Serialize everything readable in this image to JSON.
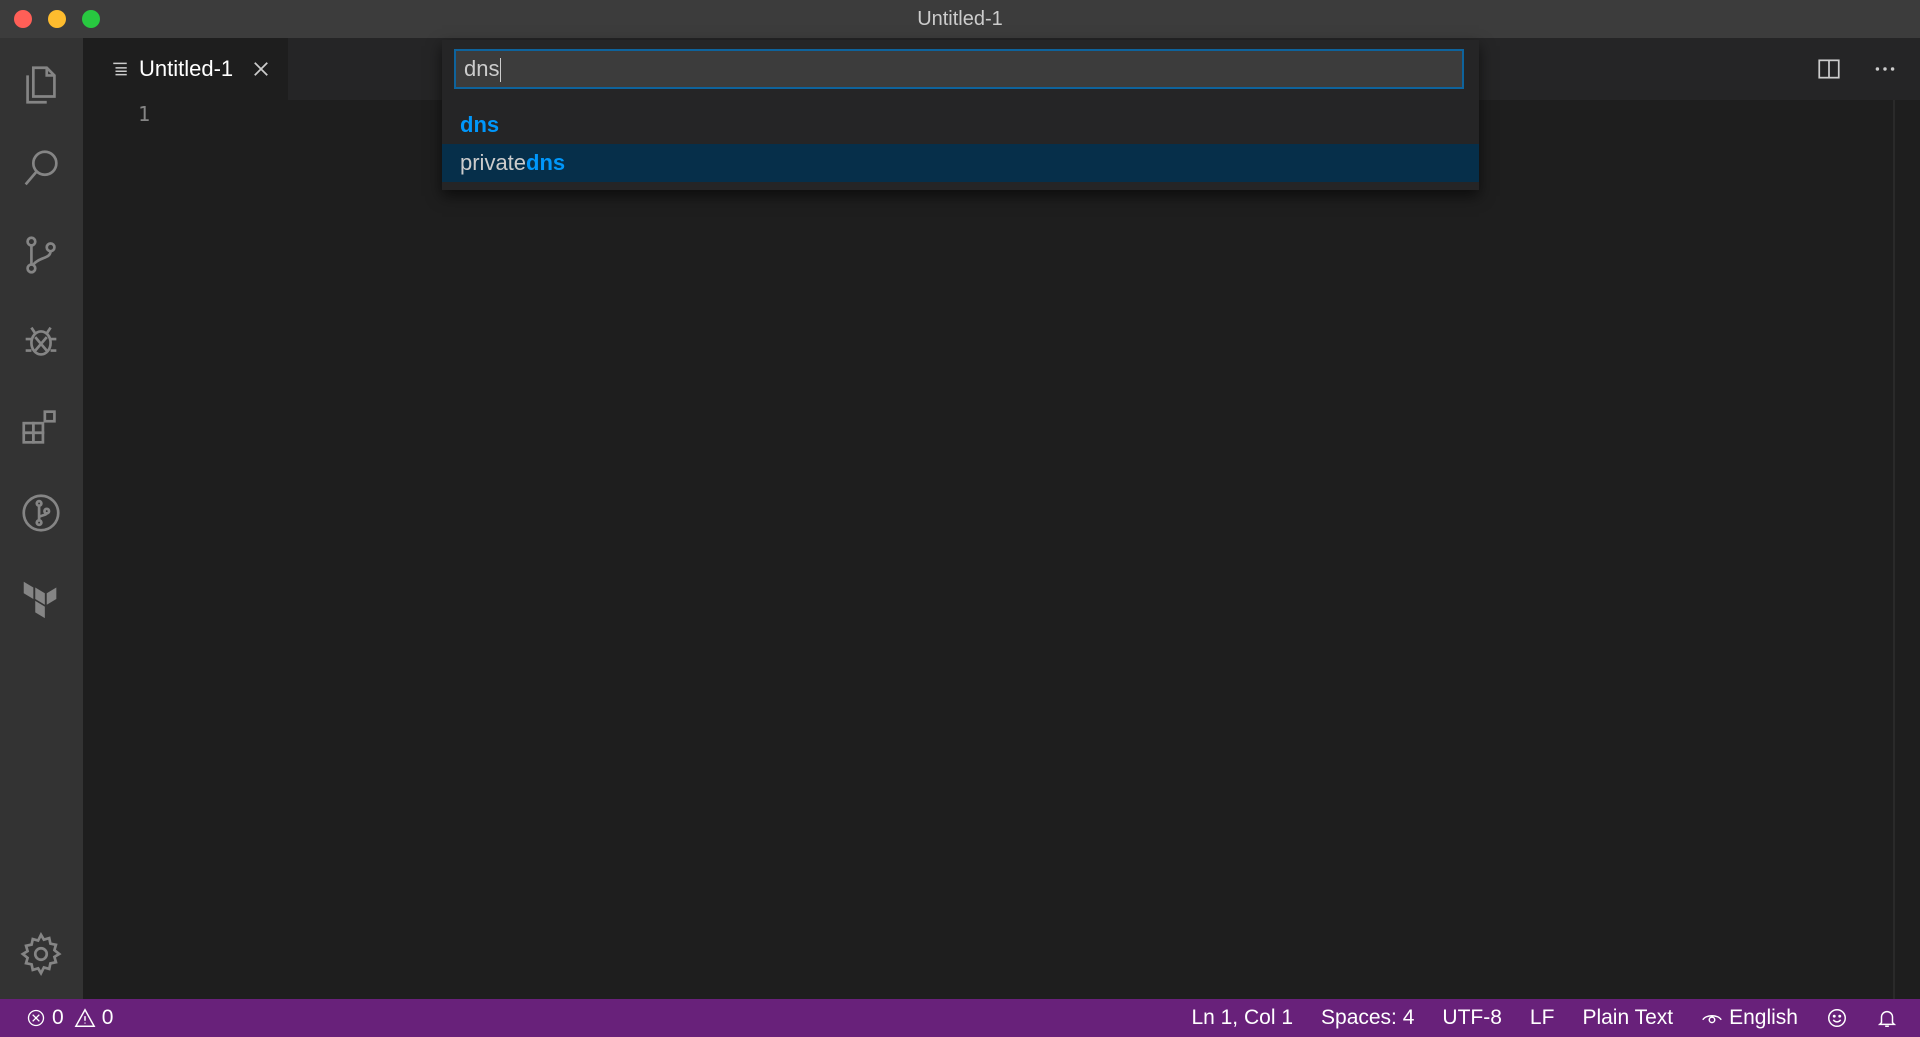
{
  "window": {
    "title": "Untitled-1"
  },
  "tabs": [
    {
      "label": "Untitled-1"
    }
  ],
  "editor": {
    "line_numbers": [
      "1"
    ]
  },
  "quick_input": {
    "value": "dns",
    "items": [
      {
        "prefix": "",
        "match": "dns"
      },
      {
        "prefix": "private",
        "match": "dns"
      }
    ],
    "selected_index": 1
  },
  "activity_bar": {
    "icons": [
      "explorer-icon",
      "search-icon",
      "source-control-icon",
      "debug-icon",
      "extensions-icon",
      "git-graph-icon",
      "terraform-icon",
      "settings-gear-icon"
    ]
  },
  "status_bar": {
    "errors": "0",
    "warnings": "0",
    "position": "Ln 1, Col 1",
    "spaces": "Spaces: 4",
    "encoding": "UTF-8",
    "eol": "LF",
    "language": "Plain Text",
    "spell_language": "English"
  },
  "colors": {
    "status_bar": "#68217a",
    "activity_bar": "#333333",
    "editor_bg": "#1e1e1e",
    "highlight": "#0097fb",
    "selection": "#062f4a"
  }
}
